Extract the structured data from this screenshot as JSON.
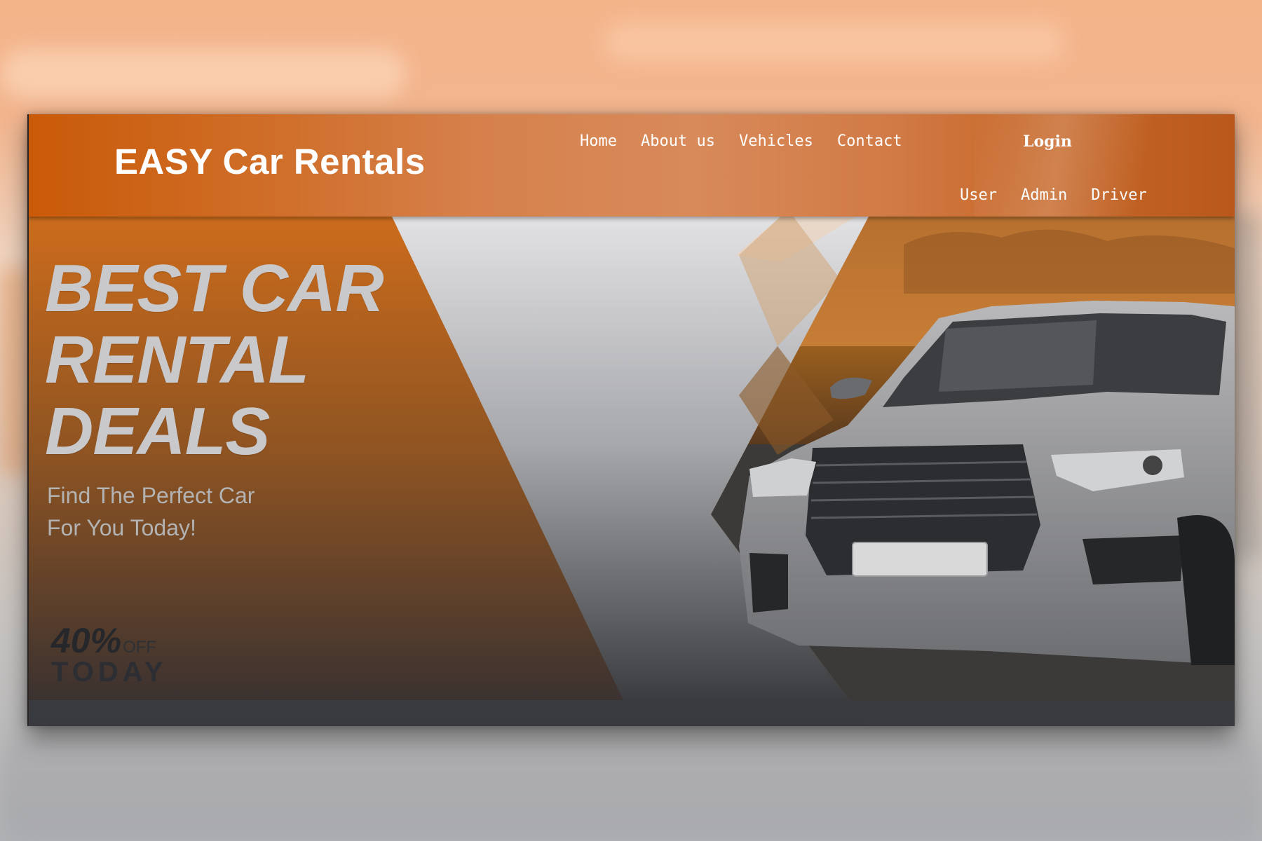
{
  "header": {
    "brand": "EASY Car Rentals",
    "nav": [
      "Home",
      "About us",
      "Vehicles",
      "Contact"
    ],
    "login_label": "Login",
    "login_options": [
      "User",
      "Admin",
      "Driver"
    ]
  },
  "hero": {
    "headline": [
      "BEST CAR",
      "RENTAL",
      "DEALS"
    ],
    "subheadline": [
      "Find The Perfect Car",
      "For You Today!"
    ],
    "promo": {
      "percent": "40%",
      "off": "OFF",
      "today": "TODAY"
    }
  },
  "colors": {
    "header_orange": "#c95a08",
    "panel_orange": "#c86a22",
    "headline_gray": "#c9c9cc"
  }
}
